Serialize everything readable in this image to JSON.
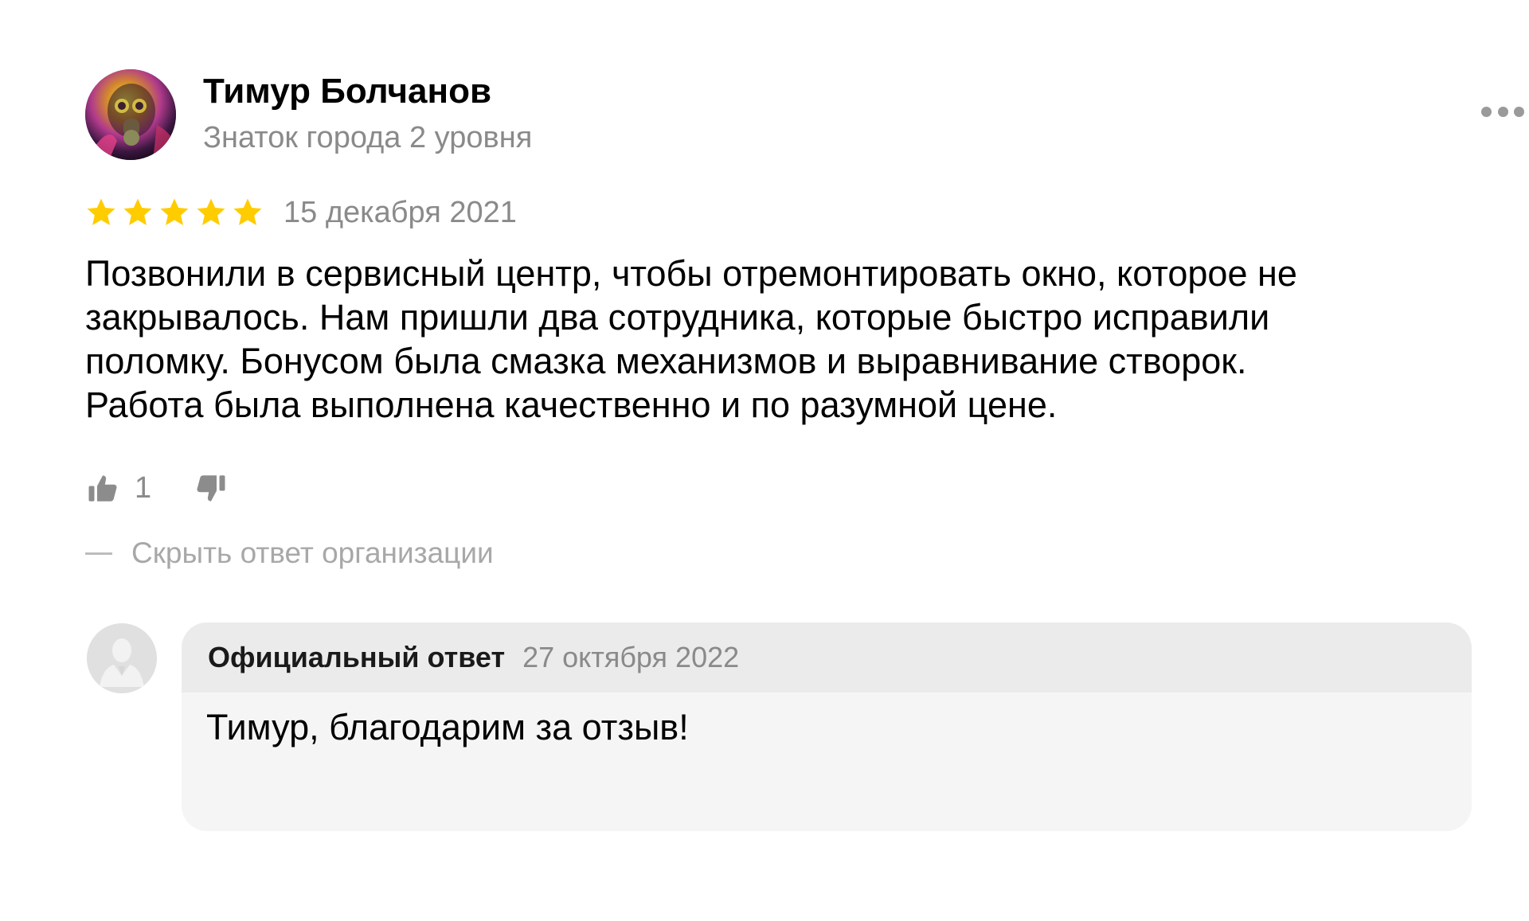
{
  "author": {
    "name": "Тимур Болчанов",
    "level": "Знаток города 2 уровня",
    "avatar_icon": "gas-mask-portrait"
  },
  "menu": {
    "icon": "more-dots-icon"
  },
  "rating": {
    "stars": 5,
    "max": 5,
    "star_color": "#FFCC00",
    "date": "15 декабря 2021"
  },
  "review": {
    "lines": [
      "Позвонили в сервисный центр, чтобы отремонтировать окно, которое не",
      "закрывалось. Нам пришли два сотрудника, которые быстро исправили",
      "поломку. Бонусом была смазка механизмов и выравнивание створок.",
      "Работа была выполнена качественно и по разумной цене."
    ]
  },
  "reactions": {
    "likes": "1",
    "like_icon": "thumbs-up-icon",
    "dislike_icon": "thumbs-down-icon"
  },
  "toggle": {
    "label": "Скрыть ответ организации"
  },
  "reply": {
    "title": "Официальный ответ",
    "date": "27 октября 2022",
    "text": "Тимур, благодарим за отзыв!",
    "avatar_icon": "organization-avatar-icon",
    "header_bg": "#EBEBEB",
    "body_bg": "#F5F5F5"
  }
}
